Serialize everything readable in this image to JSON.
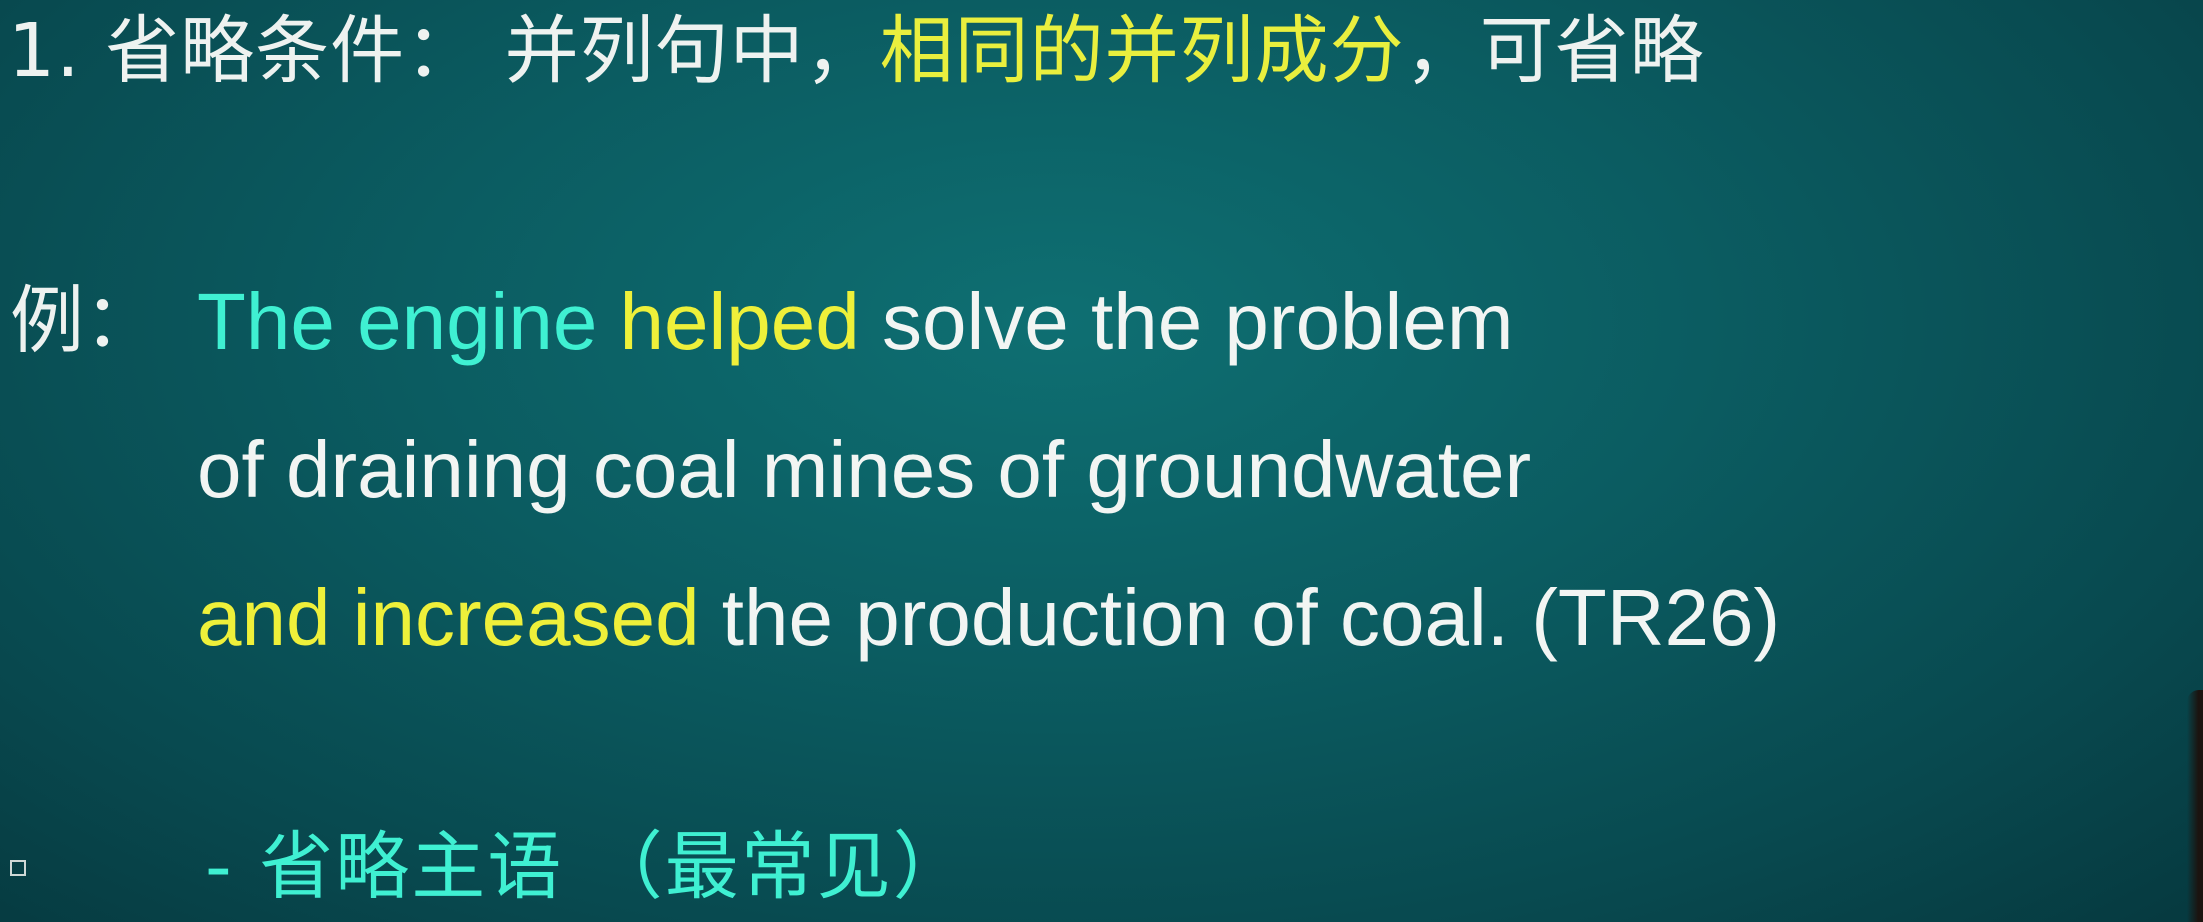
{
  "slide": {
    "heading": {
      "number": "1. ",
      "label": "省略条件：",
      "text_plain": " 并列句中，",
      "text_highlight": "相同的并列成分",
      "text_end": "，可省略"
    },
    "example": {
      "label": "例：",
      "line1": {
        "subject": "The engine ",
        "verb": "helped",
        "rest": " solve the problem"
      },
      "line2": {
        "text": "of draining coal mines of groundwater"
      },
      "line3": {
        "highlight": "and increased",
        "rest": " the production of coal. (TR26)"
      }
    },
    "sub_point": {
      "text": "- 省略主语 （最常见）"
    }
  }
}
